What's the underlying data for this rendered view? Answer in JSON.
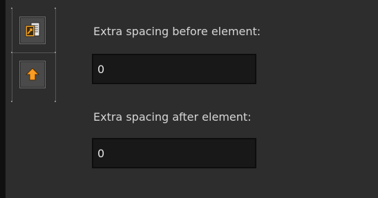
{
  "toolbar": {
    "buttons": [
      {
        "icon": "copy-replace-icon",
        "accent": "#f0a020"
      },
      {
        "icon": "arrow-up-icon",
        "accent": "#f28c10"
      }
    ]
  },
  "form": {
    "before": {
      "label": "Extra spacing before element:",
      "value": "0"
    },
    "after": {
      "label": "Extra spacing after element:",
      "value": "0"
    }
  }
}
